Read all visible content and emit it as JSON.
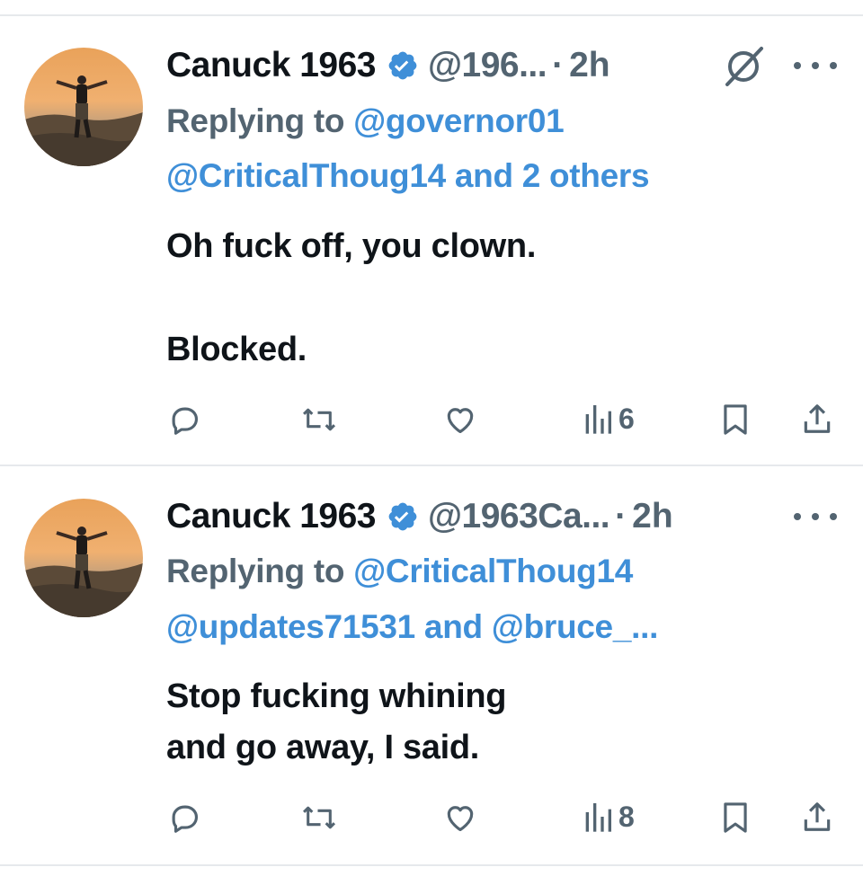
{
  "colors": {
    "text": "#0f1419",
    "muted": "#536471",
    "link": "#3f8fd8",
    "verified": "#3f8fd8",
    "divider": "#e6e9ec"
  },
  "tweets": [
    {
      "display_name": "Canuck 1963",
      "handle": "@196...",
      "separator": "·",
      "time": "2h",
      "replying_prefix": "Replying to",
      "replying_line1_mention": "@governor01",
      "replying_line2_mention": "@CriticalThoug14",
      "replying_line2_suffix": "and 2 others",
      "text_line1": "Oh fuck off, you clown.",
      "text_line2": "Blocked.",
      "views": "6",
      "icons": [
        "avatar",
        "verified-badge-icon",
        "grok-icon",
        "more-icon",
        "reply-icon",
        "retweet-icon",
        "like-icon",
        "views-icon",
        "bookmark-icon",
        "share-icon"
      ]
    },
    {
      "display_name": "Canuck 1963",
      "handle": "@1963Ca...",
      "separator": "·",
      "time": "2h",
      "replying_prefix": "Replying to",
      "replying_line1_mention": "@CriticalThoug14",
      "replying_line2_mention": "@updates71531",
      "replying_line2_and": "and",
      "replying_line2_mention2": "@bruce_...",
      "text_line1": "Stop fucking whining",
      "text_line2": "and go away, I said.",
      "views": "8",
      "icons": [
        "avatar",
        "verified-badge-icon",
        "more-icon",
        "reply-icon",
        "retweet-icon",
        "like-icon",
        "views-icon",
        "bookmark-icon",
        "share-icon"
      ]
    }
  ]
}
